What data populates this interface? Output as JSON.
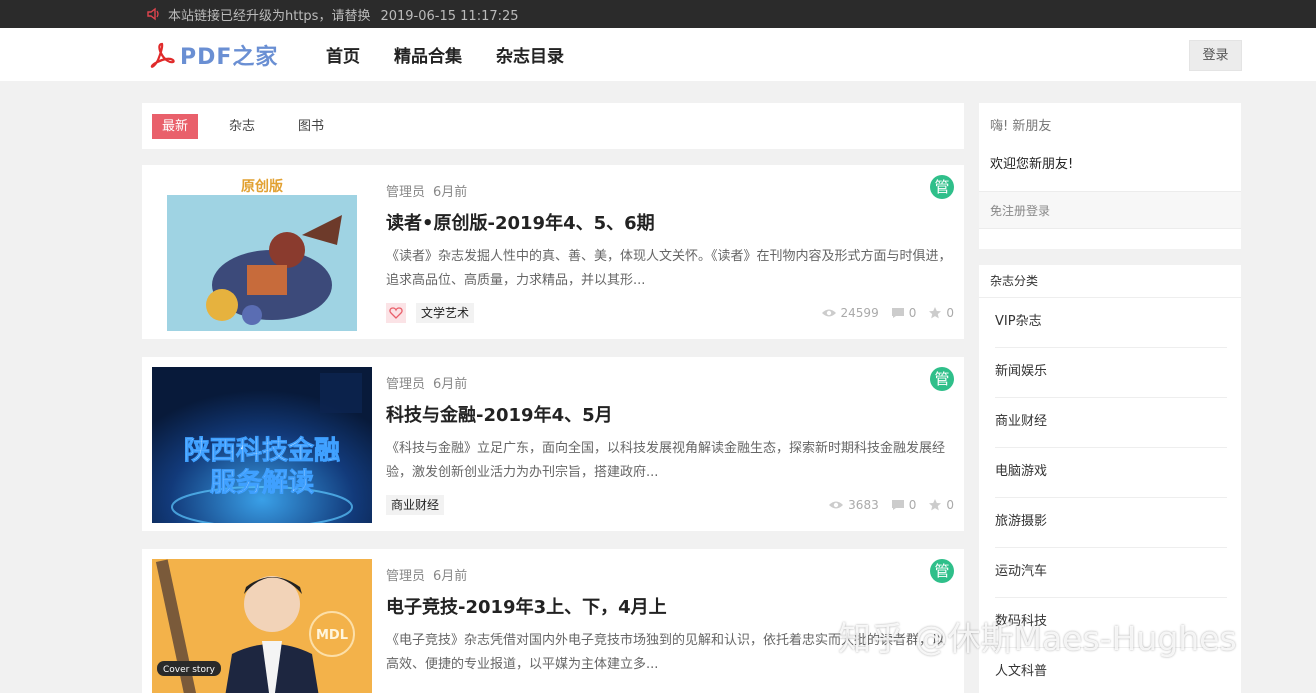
{
  "topbar": {
    "notice": "本站链接已经升级为https，请替换",
    "date": "2019-06-15 11:17:25",
    "icon": "speaker-icon"
  },
  "header": {
    "logo_text": "PDF之家",
    "nav": [
      "首页",
      "精品合集",
      "杂志目录"
    ],
    "login": "登录"
  },
  "tabs": [
    "最新",
    "杂志",
    "图书"
  ],
  "posts": [
    {
      "author": "管理员",
      "time": "6月前",
      "badge": "管",
      "title": "读者•原创版-2019年4、5、6期",
      "excerpt": "《读者》杂志发掘人性中的真、善、美，体现人文关怀。《读者》在刊物内容及形式方面与时俱进，追求高品位、高质量，力求精品，并以其形...",
      "cover_text": "原创版",
      "tag": "文学艺术",
      "views": "24599",
      "comments": "0",
      "stars": "0"
    },
    {
      "author": "管理员",
      "time": "6月前",
      "badge": "管",
      "title": "科技与金融-2019年4、5月",
      "excerpt": "《科技与金融》立足广东，面向全国，以科技发展视角解读金融生态，探索新时期科技金融发展经验，激发创新创业活力为办刊宗旨，搭建政府...",
      "cover_line1": "陕西科技金融",
      "cover_line2": "服务解读",
      "tag": "商业财经",
      "views": "3683",
      "comments": "0",
      "stars": "0"
    },
    {
      "author": "管理员",
      "time": "6月前",
      "badge": "管",
      "title": "电子竞技-2019年3上、下，4月上",
      "excerpt": "《电子竞技》杂志凭借对国内外电子竞技市场独到的见解和认识，依托着忠实而大批的读者群，以高效、便捷的专业报道，以平媒为主体建立多...",
      "cover_label": "Cover story",
      "cover_logo": "MDL"
    }
  ],
  "sidebar": {
    "welcome_hi": "嗨! 新朋友",
    "welcome_msg": "欢迎您新朋友!",
    "register": "免注册登录",
    "cat_title": "杂志分类",
    "categories": [
      "VIP杂志",
      "新闻娱乐",
      "商业财经",
      "电脑游戏",
      "旅游摄影",
      "运动汽车",
      "数码科技",
      "人文科普"
    ]
  },
  "watermark": "知乎 @休斯Maes-Hughes",
  "colors": {
    "accent": "#e9606b",
    "badge": "#2fbf8a",
    "topbar": "#2b2b2b",
    "logo": "#6a8fd3"
  }
}
